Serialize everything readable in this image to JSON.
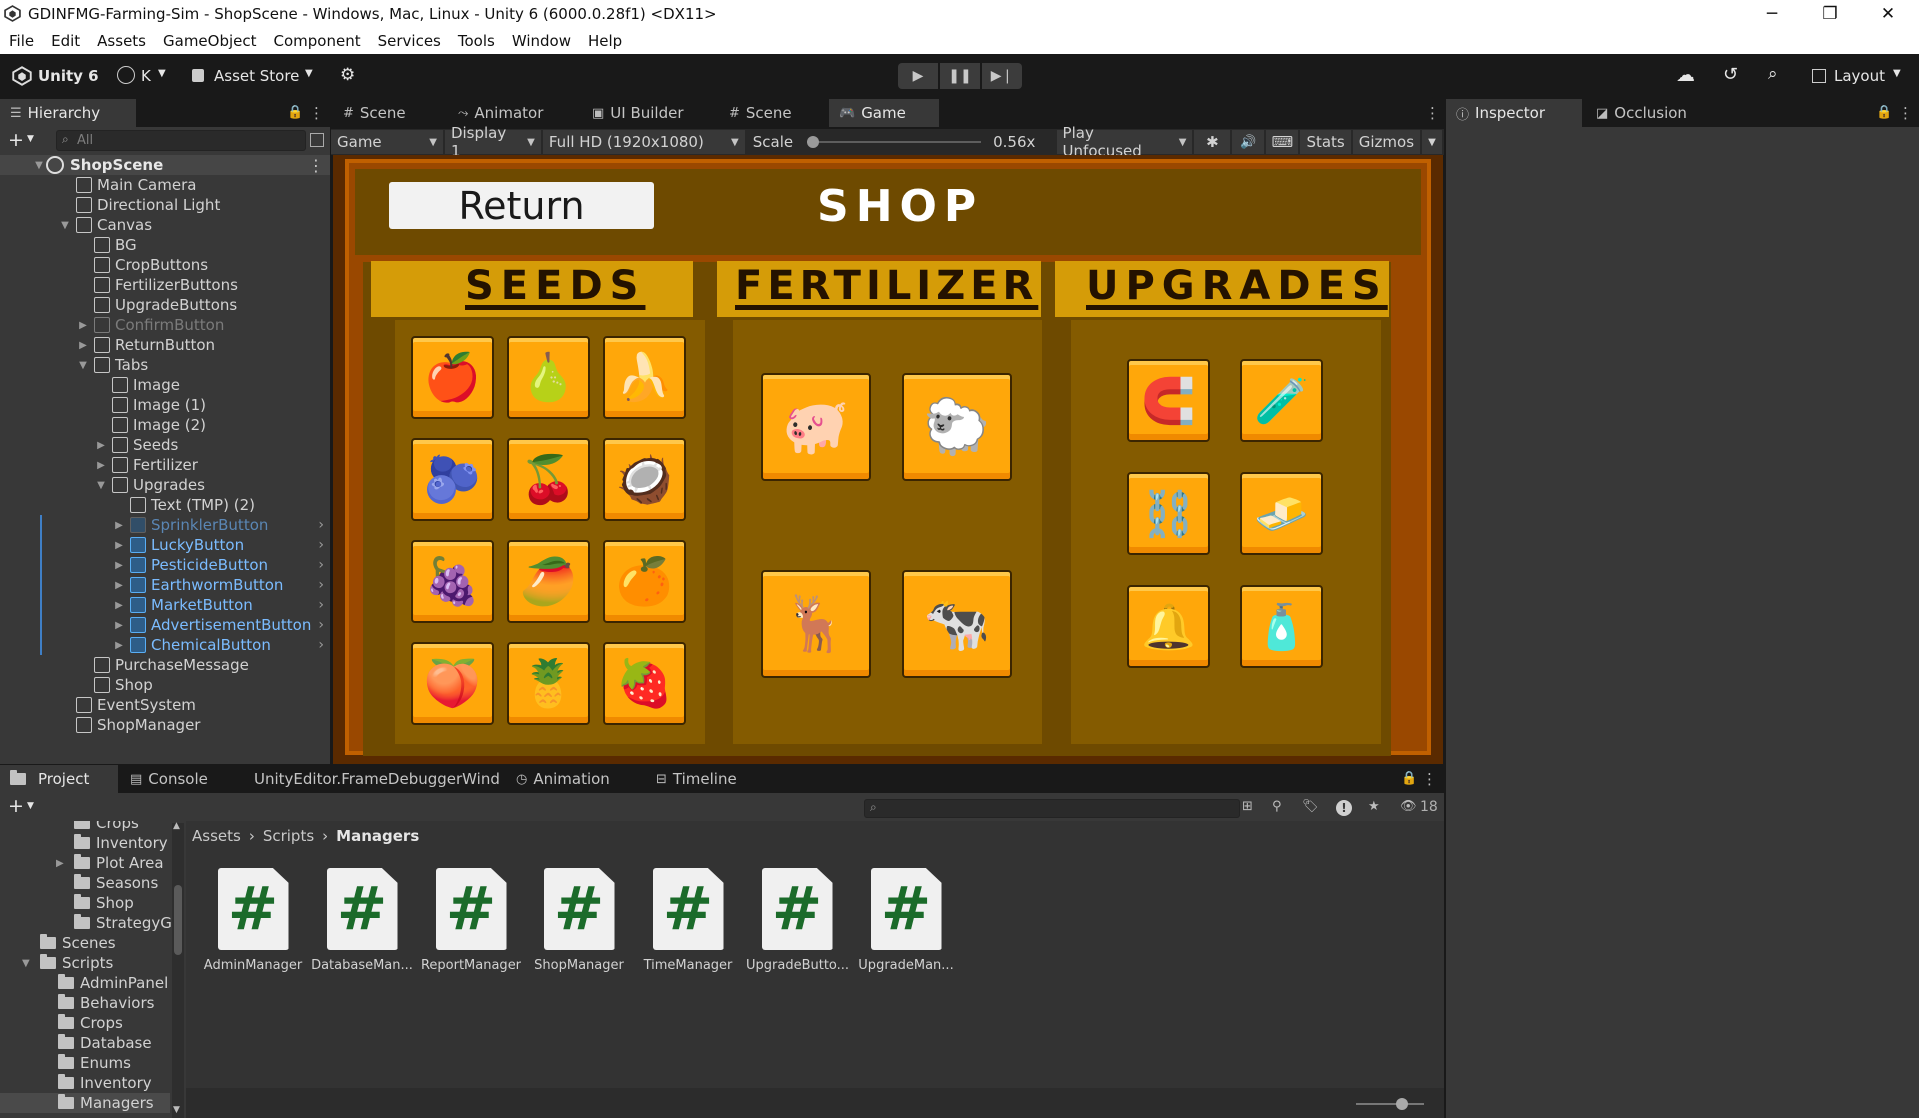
{
  "window": {
    "title": "GDINFMG-Farming-Sim - ShopScene - Windows, Mac, Linux - Unity 6 (6000.0.28f1) <DX11>",
    "minimize": "─",
    "restore": "❐",
    "close": "✕"
  },
  "menu": [
    "File",
    "Edit",
    "Assets",
    "GameObject",
    "Component",
    "Services",
    "Tools",
    "Window",
    "Help"
  ],
  "toolbar": {
    "unity_label": "Unity 6",
    "account": "K",
    "asset_store": "Asset Store",
    "layout": "Layout"
  },
  "hierarchy": {
    "tab": "Hierarchy",
    "search_placeholder": "All",
    "scene": "ShopScene",
    "items": [
      {
        "label": "Main Camera"
      },
      {
        "label": "Directional Light"
      },
      {
        "label": "Canvas"
      },
      {
        "label": "BG"
      },
      {
        "label": "CropButtons"
      },
      {
        "label": "FertilizerButtons"
      },
      {
        "label": "UpgradeButtons"
      },
      {
        "label": "ConfirmButton"
      },
      {
        "label": "ReturnButton"
      },
      {
        "label": "Tabs"
      },
      {
        "label": "Image"
      },
      {
        "label": "Image (1)"
      },
      {
        "label": "Image (2)"
      },
      {
        "label": "Seeds"
      },
      {
        "label": "Fertilizer"
      },
      {
        "label": "Upgrades"
      },
      {
        "label": "Text (TMP) (2)"
      },
      {
        "label": "SprinklerButton"
      },
      {
        "label": "LuckyButton"
      },
      {
        "label": "PesticideButton"
      },
      {
        "label": "EarthwormButton"
      },
      {
        "label": "MarketButton"
      },
      {
        "label": "AdvertisementButton"
      },
      {
        "label": "ChemicalButton"
      },
      {
        "label": "PurchaseMessage"
      },
      {
        "label": "Shop"
      },
      {
        "label": "EventSystem"
      },
      {
        "label": "ShopManager"
      }
    ]
  },
  "center_tabs": [
    "Scene",
    "Animator",
    "UI Builder",
    "Scene",
    "Game"
  ],
  "game_toolbar": {
    "mode": "Game",
    "display": "Display 1",
    "resolution": "Full HD (1920x1080)",
    "scale_label": "Scale",
    "scale_value": "0.56x",
    "play_focus": "Play Unfocused",
    "stats": "Stats",
    "gizmos": "Gizmos"
  },
  "shop": {
    "return_label": "Return",
    "title": "SHOP",
    "headers": [
      "SEEDS",
      "FERTILIZER",
      "UPGRADES"
    ],
    "seeds": [
      "🍎",
      "🍐",
      "🍌",
      "🫐",
      "🍒",
      "🥥",
      "🍇",
      "🥭",
      "🍊",
      "🍑",
      "🍍",
      "🍓"
    ],
    "fertilizers": [
      "🐖",
      "🐑",
      "🦌",
      "🐄"
    ],
    "upgrades": [
      "🧲",
      "🧪",
      "⛓️",
      "🧈",
      "🔔",
      "🧴"
    ]
  },
  "inspector_tabs": [
    "Inspector",
    "Occlusion"
  ],
  "bottom_tabs": [
    "Project",
    "Console",
    "UnityEditor.FrameDebuggerWind",
    "Animation",
    "Timeline"
  ],
  "project": {
    "visible_count": "18",
    "breadcrumb": [
      "Assets",
      "Scripts",
      "Managers"
    ],
    "tree": [
      {
        "label": "Crops"
      },
      {
        "label": "Inventory"
      },
      {
        "label": "Plot Area"
      },
      {
        "label": "Seasons"
      },
      {
        "label": "Shop"
      },
      {
        "label": "StrategyGa"
      },
      {
        "label": "Scenes"
      },
      {
        "label": "Scripts"
      },
      {
        "label": "AdminPanel"
      },
      {
        "label": "Behaviors"
      },
      {
        "label": "Crops"
      },
      {
        "label": "Database"
      },
      {
        "label": "Enums"
      },
      {
        "label": "Inventory"
      },
      {
        "label": "Managers"
      }
    ],
    "assets": [
      "AdminManager",
      "DatabaseMan...",
      "ReportManager",
      "ShopManager",
      "TimeManager",
      "UpgradeButto...",
      "UpgradeMan..."
    ]
  }
}
